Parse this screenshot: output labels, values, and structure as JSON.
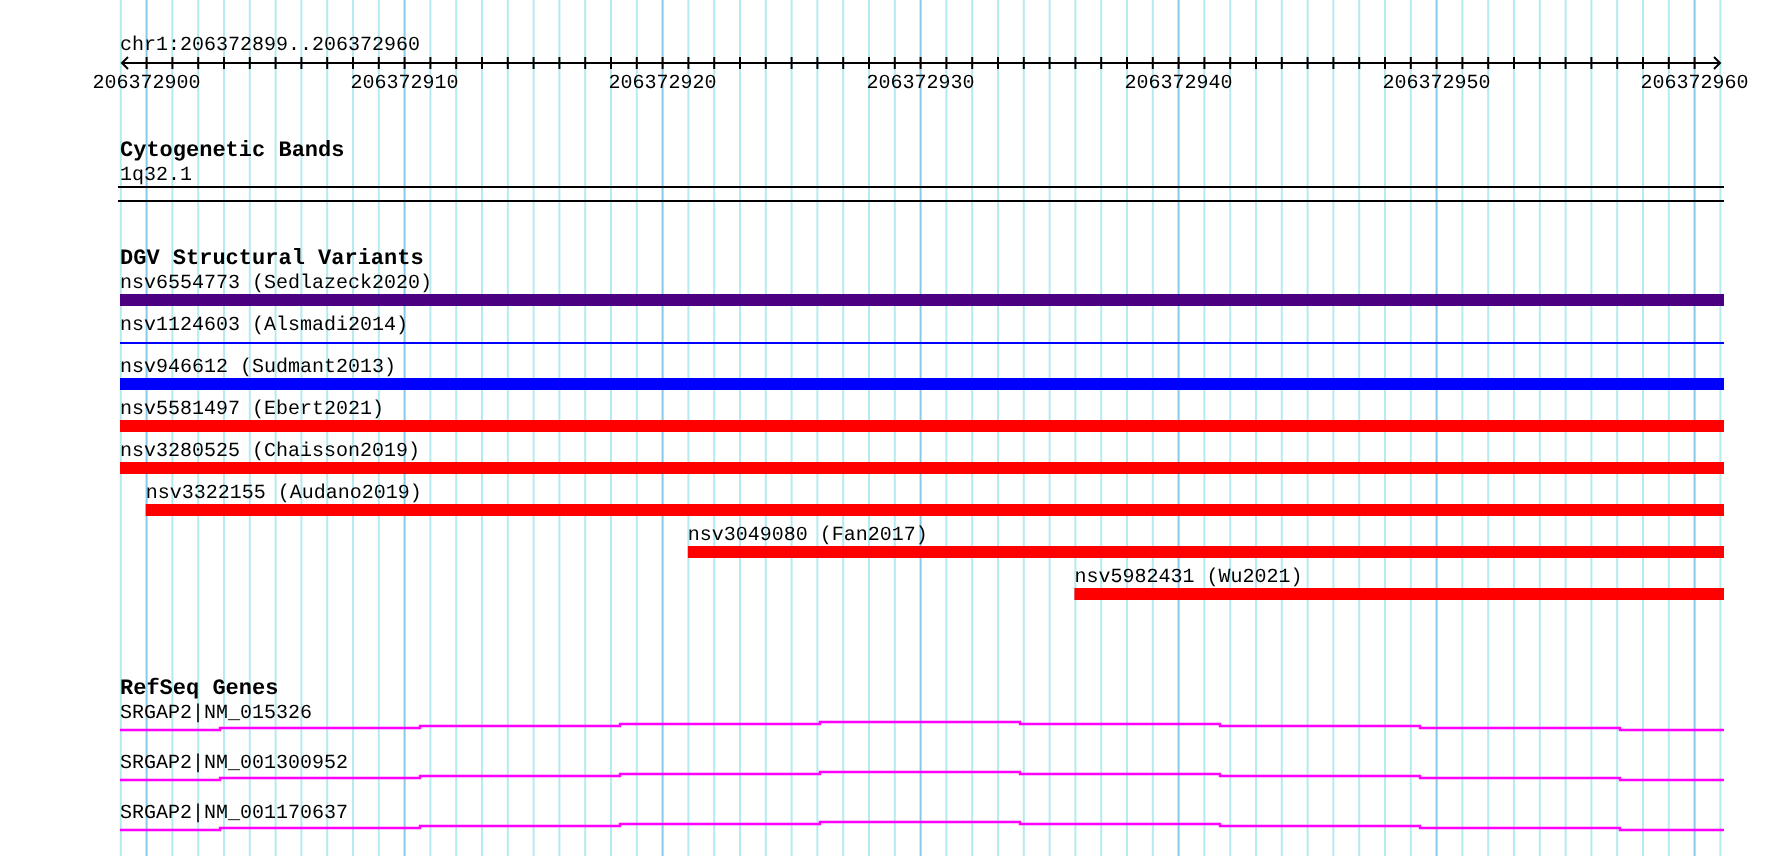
{
  "ruler": {
    "location": "chr1:206372899..206372960",
    "ticks": [
      "206372900",
      "206372910",
      "206372920",
      "206372930",
      "206372940",
      "206372950",
      "206372960"
    ]
  },
  "cytogenetic_bands": {
    "title": "Cytogenetic Bands",
    "band": "1q32.1"
  },
  "dgv_structural_variants": {
    "title": "DGV Structural Variants",
    "variants": [
      {
        "label": "nsv6554773 (Sedlazeck2020)",
        "kind": "bar",
        "color": "#4b0082",
        "level": 1
      },
      {
        "label": "nsv1124603 (Alsmadi2014)",
        "kind": "line",
        "color": "#0000ff",
        "level": 1
      },
      {
        "label": "nsv946612 (Sudmant2013)",
        "kind": "bar",
        "color": "#0000ff",
        "level": 1
      },
      {
        "label": "nsv5581497 (Ebert2021)",
        "kind": "bar",
        "color": "#ff0000",
        "level": 1
      },
      {
        "label": "nsv3280525 (Chaisson2019)",
        "kind": "bar",
        "color": "#ff0000",
        "level": 1
      },
      {
        "label": "nsv3322155 (Audano2019)",
        "kind": "bar",
        "color": "#ff0000",
        "level": 0.984
      },
      {
        "label": "nsv3049080 (Fan2017)",
        "kind": "bar",
        "color": "#ff0000",
        "level": 0.646
      },
      {
        "label": "nsv5982431 (Wu2021)",
        "kind": "bar",
        "color": "#ff0000",
        "level": 0.405
      }
    ]
  },
  "refseq_genes": {
    "title": "RefSeq Genes",
    "genes": [
      {
        "label": "SRGAP2|NM_015326"
      },
      {
        "label": "SRGAP2|NM_001300952"
      },
      {
        "label": "SRGAP2|NM_001170637"
      }
    ]
  }
}
